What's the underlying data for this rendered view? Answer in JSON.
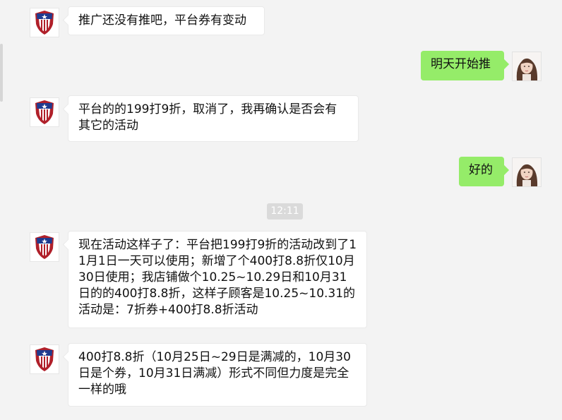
{
  "timestamp": "12:11",
  "messages": [
    {
      "side": "in",
      "text": "推广还没有推吧，平台券有变动"
    },
    {
      "side": "out",
      "text": "明天开始推"
    },
    {
      "side": "in",
      "text": "平台的的199打9折，取消了，我再确认是否会有其它的活动"
    },
    {
      "side": "out",
      "text": "好的"
    },
    {
      "side": "in",
      "text": "现在活动这样子了：平台把199打9折的活动改到了11月1日一天可以使用；新增了个400打8.8折仅10月30日使用；我店铺做个10.25~10.29日和10月31日的的400打8.8折，这样子顾客是10.25~10.31的活动是：7折券+400打8.8折活动"
    },
    {
      "side": "in",
      "text": "400打8.8折（10月25日~29日是满减的，10月30日是个券，10月31日满减）形式不同但力度是完全一样的哦"
    }
  ],
  "colors": {
    "outgoing_bubble": "#95ec69",
    "incoming_bubble": "#ffffff",
    "background": "#f3f3f3"
  },
  "icons": {
    "contact_avatar": "captain-shield-icon",
    "self_avatar": "user-photo"
  }
}
